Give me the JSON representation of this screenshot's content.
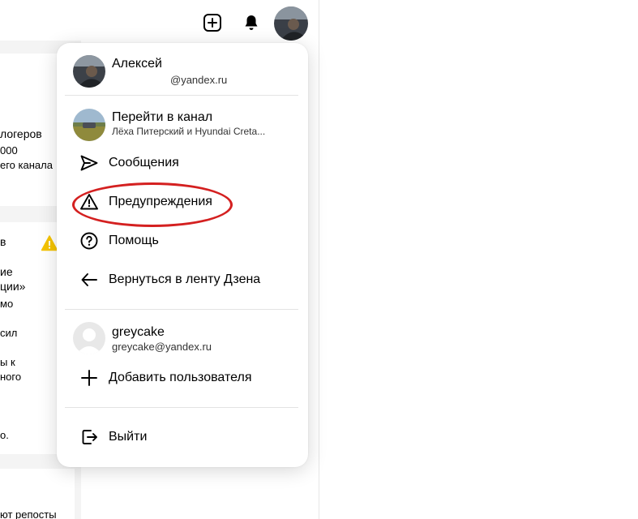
{
  "header": {
    "add_icon": "plus-square-icon",
    "bell_icon": "bell-icon",
    "avatar_icon": "user-avatar"
  },
  "background": {
    "lines": [
      "логеров",
      "000",
      "его канала",
      "в",
      "ие",
      "ции»",
      "мо",
      "сил",
      "ы к",
      "ного",
      "о.",
      "ют репосты"
    ]
  },
  "menu": {
    "account": {
      "name": "Алексей",
      "email": "@yandex.ru"
    },
    "channel": {
      "title": "Перейти в канал",
      "subtitle": "Лёха Питерский и Hyundai Creta..."
    },
    "items": [
      {
        "label": "Сообщения",
        "icon": "send-icon"
      },
      {
        "label": "Предупреждения",
        "icon": "warning-triangle-icon"
      },
      {
        "label": "Помощь",
        "icon": "help-circle-icon"
      },
      {
        "label": "Вернуться в ленту Дзена",
        "icon": "arrow-left-icon"
      }
    ],
    "other_account": {
      "name": "greycake",
      "email": "greycake@yandex.ru"
    },
    "add_user": {
      "label": "Добавить пользователя",
      "icon": "plus-icon"
    },
    "logout": {
      "label": "Выйти",
      "icon": "logout-icon"
    }
  },
  "colors": {
    "highlight": "#d42020",
    "warning": "#f5c400"
  }
}
